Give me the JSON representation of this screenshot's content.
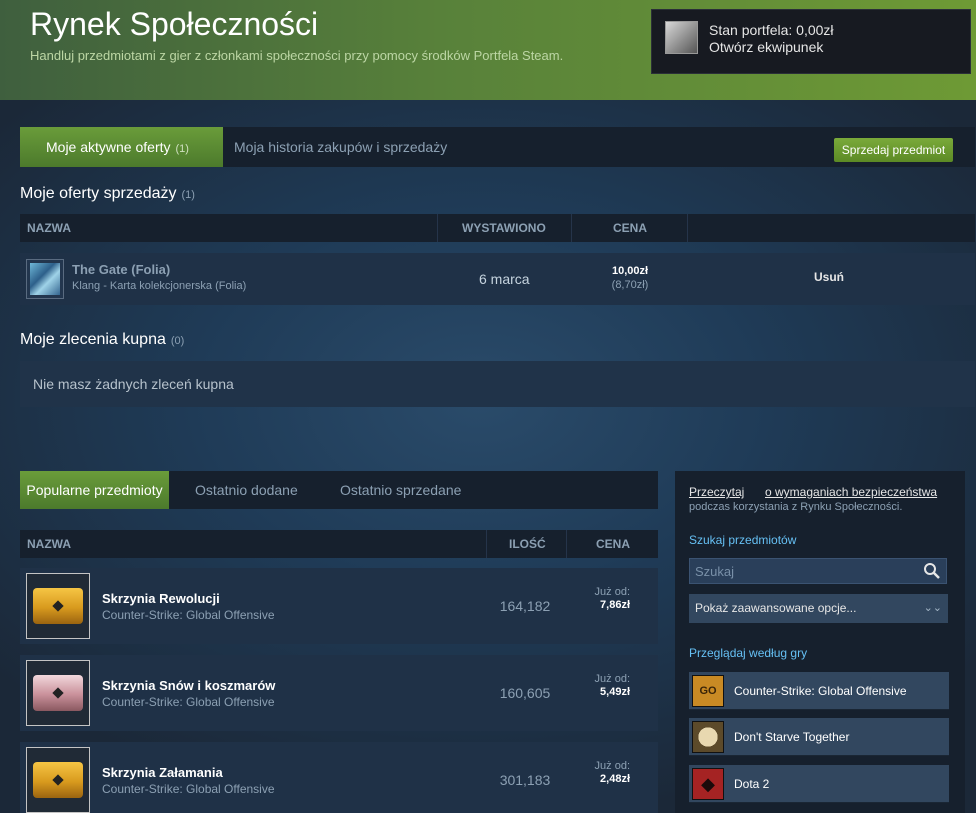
{
  "hero": {
    "title": "Rynek Społeczności",
    "subtitle": "Handluj przedmiotami z gier z członkami społeczności przy pomocy środków Portfela Steam."
  },
  "wallet": {
    "balance": "Stan portfela: 0,00zł",
    "inventory_link": "Otwórz ekwipunek"
  },
  "tabs": {
    "active_label": "Moje aktywne oferty",
    "active_count": "(1)",
    "history_label": "Moja historia zakupów i sprzedaży",
    "sell_button": "Sprzedaj przedmiot"
  },
  "listings": {
    "title": "Moje oferty sprzedaży",
    "count": "(1)",
    "headers": {
      "name": "NAZWA",
      "listed": "WYSTAWIONO",
      "price": "CENA"
    },
    "rows": [
      {
        "name": "The Gate (Folia)",
        "game": "Klang - Karta kolekcjonerska (Folia)",
        "date": "6 marca",
        "price": "10,00zł",
        "price_net": "(8,70zł)",
        "action": "Usuń"
      }
    ]
  },
  "buy_orders": {
    "title": "Moje zlecenia kupna",
    "count": "(0)",
    "empty_text": "Nie masz żadnych zleceń kupna"
  },
  "popular": {
    "tabs": [
      "Popularne przedmioty",
      "Ostatnio dodane",
      "Ostatnio sprzedane"
    ],
    "headers": {
      "name": "NAZWA",
      "qty": "ILOŚĆ",
      "price": "CENA"
    },
    "items": [
      {
        "name": "Skrzynia Rewolucji",
        "game": "Counter-Strike: Global Offensive",
        "qty": "164,182",
        "from": "Już od:",
        "price": "7,86zł",
        "icon": "gold-case"
      },
      {
        "name": "Skrzynia Snów i koszmarów",
        "game": "Counter-Strike: Global Offensive",
        "qty": "160,605",
        "from": "Już od:",
        "price": "5,49zł",
        "icon": "pink-case"
      },
      {
        "name": "Skrzynia Załamania",
        "game": "Counter-Strike: Global Offensive",
        "qty": "301,183",
        "from": "Już od:",
        "price": "2,48zł",
        "icon": "gold-case"
      }
    ]
  },
  "sidebar": {
    "read_link": "Przeczytaj",
    "security_link": "o wymaganiach bezpieczeństwa",
    "note": "podczas korzystania z Rynku Społeczności.",
    "search_label": "Szukaj przedmiotów",
    "search_placeholder": "Szukaj",
    "advanced": "Pokaż zaawansowane opcje...",
    "browse_label": "Przeglądaj według gry",
    "games": [
      {
        "name": "Counter-Strike: Global Offensive",
        "icon": "cs-go-icon",
        "icon_text": "GO"
      },
      {
        "name": "Don't Starve Together",
        "icon": "dst-icon"
      },
      {
        "name": "Dota 2",
        "icon": "dota-icon"
      }
    ]
  },
  "colors": {
    "background": "#1b2838",
    "accent_green": "#5c8a25",
    "link_blue": "#66c0f4"
  }
}
